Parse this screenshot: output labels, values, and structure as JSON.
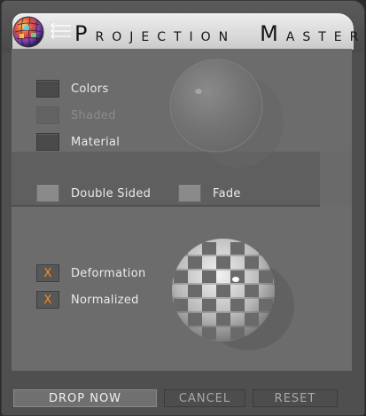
{
  "window": {
    "title_first_initial": "P",
    "title_first_rest": "ROJECTION",
    "title_second_initial": "M",
    "title_second_rest": "ASTER",
    "logo_icon": "projection-master-sphere-icon"
  },
  "options_top": [
    {
      "label": "Colors",
      "checked": false,
      "enabled": true
    },
    {
      "label": "Shaded",
      "checked": false,
      "enabled": false
    },
    {
      "label": "Material",
      "checked": false,
      "enabled": true
    }
  ],
  "options_mid": [
    {
      "label": "Double Sided",
      "checked": false,
      "enabled": true
    },
    {
      "label": "Fade",
      "checked": false,
      "enabled": true
    }
  ],
  "options_bottom": [
    {
      "label": "Deformation",
      "checked": true,
      "mark": "X",
      "enabled": true
    },
    {
      "label": "Normalized",
      "checked": true,
      "mark": "X",
      "enabled": true
    }
  ],
  "buttons": {
    "drop_now": "DROP NOW",
    "cancel": "CANCEL",
    "reset": "RESET"
  },
  "colors": {
    "check_mark": "#ff8c1a",
    "panel": "#6c6c6c",
    "background": "#4f4f4f"
  }
}
